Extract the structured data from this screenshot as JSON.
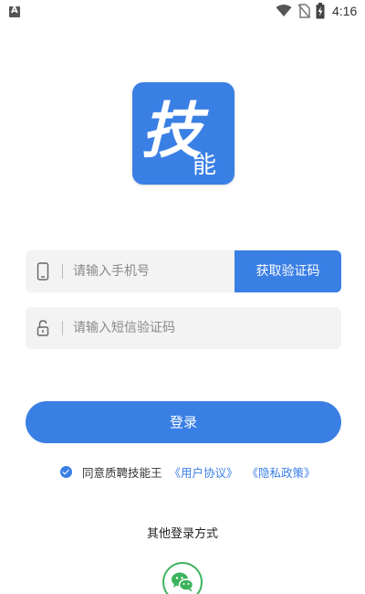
{
  "status_bar": {
    "time": "4:16",
    "icons": [
      "notification-a-icon",
      "wifi-icon",
      "no-sim-icon",
      "battery-charging-icon"
    ]
  },
  "logo": {
    "text_main": "技",
    "text_sub": "能",
    "color": "#3a7fe4"
  },
  "phone": {
    "placeholder": "请输入手机号",
    "icon": "phone-icon",
    "get_code_label": "获取验证码"
  },
  "code": {
    "placeholder": "请输入短信验证码",
    "icon": "lock-icon"
  },
  "login": {
    "label": "登录"
  },
  "agreement": {
    "checked": true,
    "text": "同意质聘技能王",
    "user_agreement": "《用户协议》",
    "privacy_policy": "《隐私政策》"
  },
  "other_login": {
    "label": "其他登录方式",
    "wechat_icon": "wechat-icon",
    "wechat_color": "#3cb35c"
  },
  "colors": {
    "primary": "#3a7fe4",
    "input_bg": "#f3f3f3",
    "placeholder": "#8a8a8a"
  }
}
